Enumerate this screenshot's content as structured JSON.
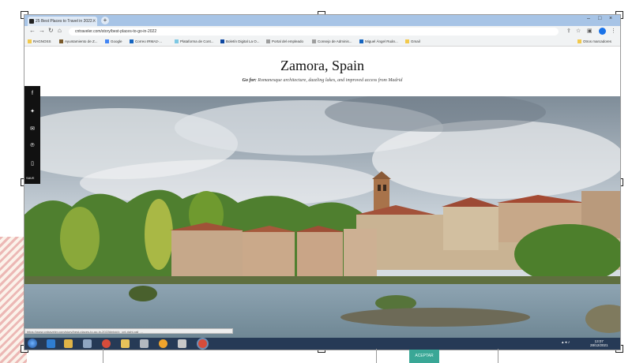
{
  "browser": {
    "tab_title": "25 Best Places to Travel in 2022...",
    "tab_close": "×",
    "new_tab": "+",
    "url": "cntraveler.com/story/best-places-to-go-in-2022",
    "window_buttons": [
      "–",
      "□",
      "×"
    ]
  },
  "bookmarks": [
    {
      "label": "RAGNOSS",
      "color": "#f2c94c"
    },
    {
      "label": "Ayuntamiento de Z...",
      "color": "#7a5a2a"
    },
    {
      "label": "Google",
      "color": "#4285f4"
    },
    {
      "label": "Correo IRMA2-...",
      "color": "#1565c0"
    },
    {
      "label": "Plataforma de Cont...",
      "color": "#7ec8e3"
    },
    {
      "label": "Boletín Digital La O...",
      "color": "#0d47a1"
    },
    {
      "label": "Portal del empleado",
      "color": "#9e9e9e"
    },
    {
      "label": "Consejo de Adminis...",
      "color": "#9e9e9e"
    },
    {
      "label": "Miguel Ángel Ruán...",
      "color": "#1565c0"
    },
    {
      "label": "Gmail",
      "color": "#f2c94c"
    },
    {
      "label": "Otros marcadores",
      "color": "#f2c94c"
    }
  ],
  "article": {
    "title": "Zamora, Spain",
    "goto_label": "Go for:",
    "goto_text": "Romanesque architecture, dazzling lakes, and improved access from Madrid"
  },
  "share_bar": {
    "icons": [
      "facebook-icon",
      "twitter-icon",
      "email-icon",
      "pinterest-icon",
      "bookmark-icon"
    ],
    "save_label": "SAVE"
  },
  "status_url": "https://www.cntraveler.com/story/best-places-to-go-in-2022#intcid=_cnt-right-rail_...",
  "taskbar": {
    "clock_time": "13:07",
    "clock_date": "28/12/2021"
  },
  "below_button": "ACEPTAR",
  "colors": {
    "tab_strip": "#a7c4e6",
    "taskbar": "#263a56",
    "accent_button": "#3aa796"
  }
}
